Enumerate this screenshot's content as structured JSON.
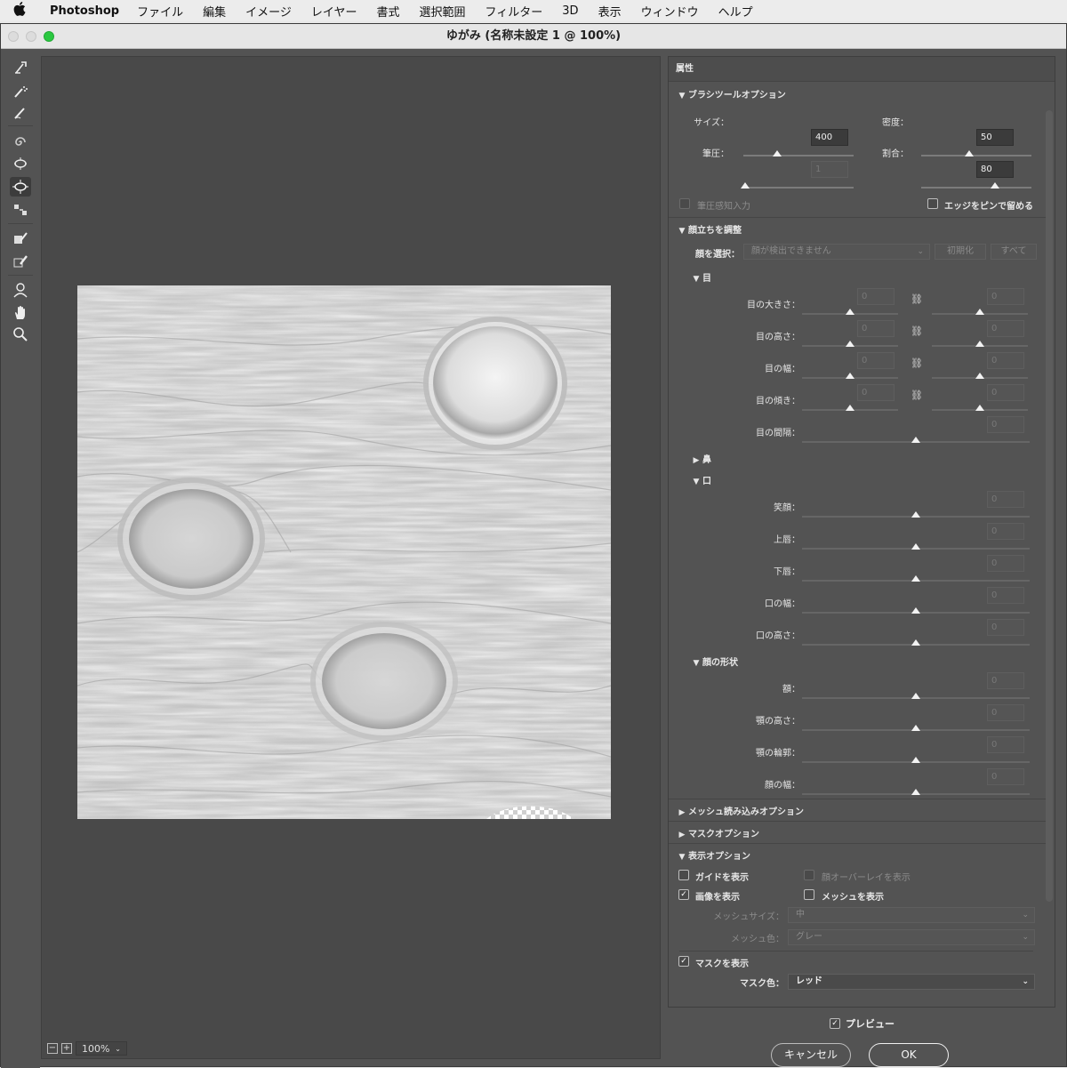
{
  "menubar": {
    "app": "Photoshop",
    "items": [
      "ファイル",
      "編集",
      "イメージ",
      "レイヤー",
      "書式",
      "選択範囲",
      "フィルター",
      "3D",
      "表示",
      "ウィンドウ",
      "ヘルプ"
    ]
  },
  "window": {
    "title": "ゆがみ (名称未設定 1 @ 100%)"
  },
  "toolbar": {
    "tools": [
      "forward-warp",
      "reconstruct",
      "smooth",
      "twirl",
      "pucker",
      "bloat",
      "push-left",
      "freeze-mask",
      "thaw-mask",
      "face",
      "hand",
      "zoom"
    ],
    "active": "bloat"
  },
  "canvas": {
    "zoom": "100%"
  },
  "panel": {
    "title": "属性",
    "brush": {
      "header": "ブラシツールオプション",
      "size_label": "サイズ：",
      "size": "400",
      "density_label": "密度：",
      "density": "50",
      "pressure_label": "筆圧：",
      "pressure": "1",
      "rate_label": "割合：",
      "rate": "80",
      "stylus_label": "筆圧感知入力",
      "pin_edges_label": "エッジをピンで留める"
    },
    "face": {
      "header": "顔立ちを調整",
      "select_label": "顔を選択：",
      "select_value": "顔が検出できません",
      "reset_label": "初期化",
      "all_label": "すべて",
      "eyes_header": "目",
      "eye_size": "目の大きさ：",
      "eye_height": "目の高さ：",
      "eye_width": "目の幅：",
      "eye_tilt": "目の傾き：",
      "eye_distance": "目の間隔：",
      "nose_header": "鼻",
      "mouth_header": "口",
      "smile": "笑顔：",
      "upper_lip": "上唇：",
      "lower_lip": "下唇：",
      "mouth_width": "口の幅：",
      "mouth_height": "口の高さ：",
      "shape_header": "顔の形状",
      "forehead": "額：",
      "chin_height": "顎の高さ：",
      "jawline": "顎の輪郭：",
      "face_width": "顔の幅：",
      "zero": "0"
    },
    "mesh": {
      "header": "メッシュ読み込みオプション"
    },
    "mask": {
      "header": "マスクオプション"
    },
    "view": {
      "header": "表示オプション",
      "show_guides": "ガイドを表示",
      "show_face_overlay": "顔オーバーレイを表示",
      "show_image": "画像を表示",
      "show_mesh": "メッシュを表示",
      "mesh_size_label": "メッシュサイズ：",
      "mesh_size_value": "中",
      "mesh_color_label": "メッシュ色：",
      "mesh_color_value": "グレー",
      "show_mask": "マスクを表示",
      "mask_color_label": "マスク色：",
      "mask_color_value": "レッド"
    }
  },
  "footer": {
    "preview_label": "プレビュー",
    "cancel_label": "キャンセル",
    "ok_label": "OK"
  },
  "colors": {
    "panel_bg": "#535353",
    "canvas_bg": "#494949",
    "traffic_red": "#dcdcdc",
    "traffic_green": "#2ac840"
  }
}
